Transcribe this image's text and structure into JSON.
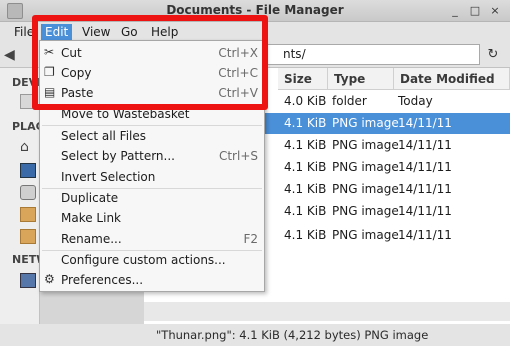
{
  "window": {
    "title": "Documents - File Manager",
    "controls": [
      "_",
      "□",
      "×"
    ]
  },
  "menubar": {
    "items": [
      "File",
      "Edit",
      "View",
      "Go",
      "Help"
    ],
    "active": "Edit"
  },
  "toolbar": {
    "location_text": "nts/"
  },
  "sidebar": {
    "sections": [
      "DEVI",
      "PLAC",
      "NETW"
    ]
  },
  "file_list": {
    "columns": [
      "Size",
      "Type",
      "Date Modified"
    ],
    "rows": [
      {
        "size": "4.0 KiB",
        "type": "folder",
        "date": "Today"
      },
      {
        "size": "4.1 KiB",
        "type": "PNG image",
        "date": "14/11/11"
      },
      {
        "size": "4.1 KiB",
        "type": "PNG image",
        "date": "14/11/11"
      },
      {
        "size": "4.1 KiB",
        "type": "PNG image",
        "date": "14/11/11"
      },
      {
        "size": "4.1 KiB",
        "type": "PNG image",
        "date": "14/11/11"
      },
      {
        "size": "4.1 KiB",
        "type": "PNG image",
        "date": "14/11/11"
      },
      {
        "size": "4.1 KiB",
        "type": "PNG image",
        "date": "14/11/11"
      }
    ],
    "selected_row_index": 1
  },
  "status_bar": {
    "text": "\"Thunar.png\": 4.1 KiB (4,212 bytes) PNG image"
  },
  "edit_menu": {
    "items": [
      {
        "label": "Cut",
        "shortcut": "Ctrl+X",
        "icon": "scissors-icon"
      },
      {
        "label": "Copy",
        "shortcut": "Ctrl+C",
        "icon": "copy-icon"
      },
      {
        "label": "Paste",
        "shortcut": "Ctrl+V",
        "icon": "paste-icon"
      },
      {
        "label": "Move to Wastebasket",
        "shortcut": ""
      },
      {
        "label": "Select all Files",
        "shortcut": ""
      },
      {
        "label": "Select by Pattern...",
        "shortcut": "Ctrl+S"
      },
      {
        "label": "Invert Selection",
        "shortcut": ""
      },
      {
        "label": "Duplicate",
        "shortcut": ""
      },
      {
        "label": "Make Link",
        "shortcut": ""
      },
      {
        "label": "Rename...",
        "shortcut": "F2"
      },
      {
        "label": "Configure custom actions...",
        "shortcut": ""
      },
      {
        "label": "Preferences...",
        "shortcut": "",
        "icon": "preferences-icon"
      }
    ]
  },
  "colors": {
    "accent": "#4a90d9",
    "highlight_annotation": "#ee1313"
  }
}
